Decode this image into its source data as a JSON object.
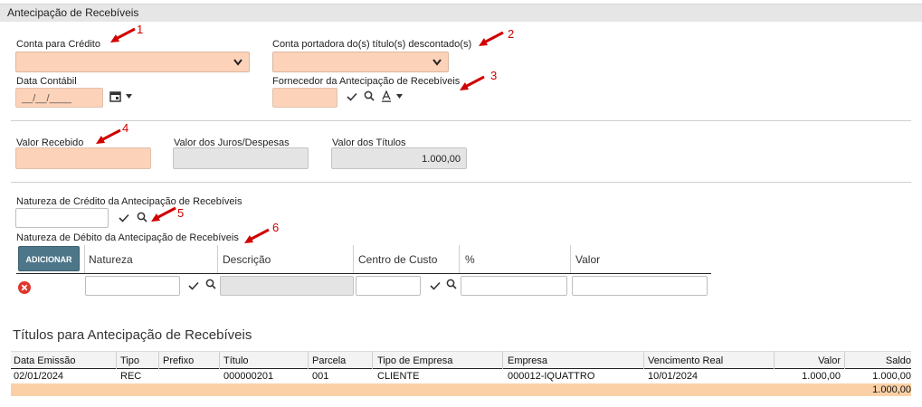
{
  "window_title": "Antecipação de Recebíveis",
  "form": {
    "conta_credito_label": "Conta para Crédito",
    "conta_portadora_label": "Conta portadora do(s) título(s) descontado(s)",
    "data_contabil_label": "Data Contábil",
    "data_contabil_placeholder": "__/__/____",
    "fornecedor_label": "Fornecedor da Antecipação de Recebíveis",
    "valor_recebido_label": "Valor Recebido",
    "valor_juros_label": "Valor dos Juros/Despesas",
    "valor_titulos_label": "Valor dos Títulos",
    "valor_titulos_value": "1.000,00",
    "natureza_credito_label": "Natureza de Crédito da Antecipação de Recebíveis",
    "natureza_debito_label": "Natureza de Débito da Antecipação de Recebíveis"
  },
  "annotations": [
    "1",
    "2",
    "3",
    "4",
    "5",
    "6"
  ],
  "debito_grid": {
    "add_button": "ADICIONAR",
    "columns": [
      "Natureza",
      "Descrição",
      "Centro de Custo",
      "%",
      "Valor"
    ]
  },
  "titulos": {
    "heading": "Títulos para Antecipação de Recebíveis",
    "columns": [
      "Data Emissão",
      "Tipo",
      "Prefixo",
      "Título",
      "Parcela",
      "Tipo de Empresa",
      "Empresa",
      "Vencimento Real",
      "Valor",
      "Saldo"
    ],
    "rows": [
      [
        "02/01/2024",
        "REC",
        "",
        "000000201",
        "001",
        "CLIENTE",
        "000012-IQUATTRO",
        "10/01/2024",
        "1.000,00",
        "1.000,00"
      ]
    ],
    "total_saldo": "1.000,00"
  },
  "colors": {
    "required_field": "#fcd2b9",
    "readonly_field": "#e4e4e4",
    "add_button": "#4d7689",
    "annotation_arrow": "#d00000",
    "total_row": "#fbd0a6"
  }
}
